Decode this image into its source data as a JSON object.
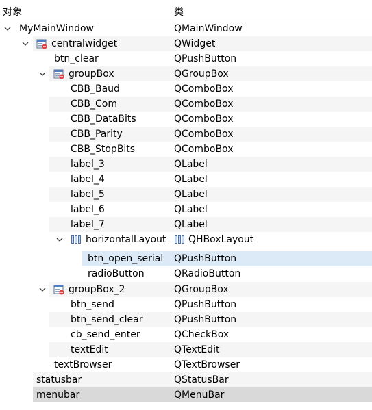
{
  "header": {
    "col_object": "对象",
    "col_class": "类"
  },
  "rows": [
    {
      "name": "MyMainWindow",
      "cls": "QMainWindow"
    },
    {
      "name": "centralwidget",
      "cls": "QWidget"
    },
    {
      "name": "btn_clear",
      "cls": "QPushButton"
    },
    {
      "name": "groupBox",
      "cls": "QGroupBox"
    },
    {
      "name": "CBB_Baud",
      "cls": "QComboBox"
    },
    {
      "name": "CBB_Com",
      "cls": "QComboBox"
    },
    {
      "name": "CBB_DataBits",
      "cls": "QComboBox"
    },
    {
      "name": "CBB_Parity",
      "cls": "QComboBox"
    },
    {
      "name": "CBB_StopBits",
      "cls": "QComboBox"
    },
    {
      "name": "label_3",
      "cls": "QLabel"
    },
    {
      "name": "label_4",
      "cls": "QLabel"
    },
    {
      "name": "label_5",
      "cls": "QLabel"
    },
    {
      "name": "label_6",
      "cls": "QLabel"
    },
    {
      "name": "label_7",
      "cls": "QLabel"
    },
    {
      "name": "horizontalLayout",
      "cls": "QHBoxLayout"
    },
    {
      "name": "btn_open_serial",
      "cls": "QPushButton"
    },
    {
      "name": "radioButton",
      "cls": "QRadioButton"
    },
    {
      "name": "groupBox_2",
      "cls": "QGroupBox"
    },
    {
      "name": "btn_send",
      "cls": "QPushButton"
    },
    {
      "name": "btn_send_clear",
      "cls": "QPushButton"
    },
    {
      "name": "cb_send_enter",
      "cls": "QCheckBox"
    },
    {
      "name": "textEdit",
      "cls": "QTextEdit"
    },
    {
      "name": "textBrowser",
      "cls": "QTextBrowser"
    },
    {
      "name": "statusbar",
      "cls": "QStatusBar"
    },
    {
      "name": "menubar",
      "cls": "QMenuBar"
    }
  ],
  "colors": {
    "alt_row": "#f5f5f5",
    "selected_row": "#dce9f6",
    "dark_row": "#d9d9d9"
  }
}
